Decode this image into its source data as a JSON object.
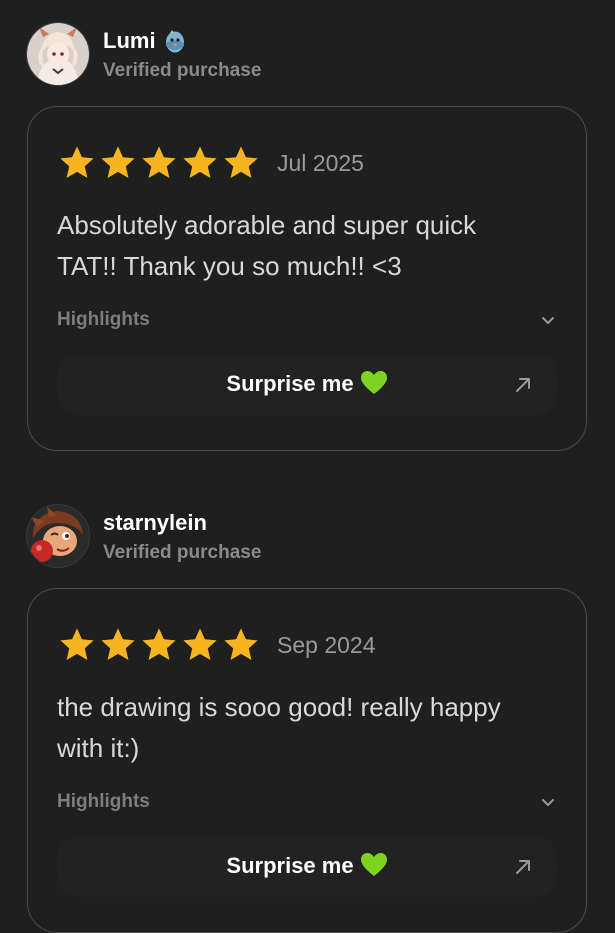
{
  "reviews": [
    {
      "reviewer": {
        "name": "Lumi",
        "status": "Verified purchase",
        "badge_icon": "egg-creature-icon",
        "avatar_icon": "anime-girl-avatar"
      },
      "rating": 5,
      "rating_max": 5,
      "date": "Jul 2025",
      "text": "Absolutely adorable and super quick TAT!! Thank you so much!! <3",
      "highlights_label": "Highlights",
      "option": {
        "label": "Surprise me",
        "emoji": "💚",
        "icon": "arrow-up-right-icon"
      }
    },
    {
      "reviewer": {
        "name": "starnylein",
        "status": "Verified purchase",
        "avatar_icon": "cartoon-boy-avatar"
      },
      "rating": 5,
      "rating_max": 5,
      "date": "Sep 2024",
      "text": "the drawing is sooo good! really happy with it:)",
      "highlights_label": "Highlights",
      "option": {
        "label": "Surprise me",
        "emoji": "💚",
        "icon": "arrow-up-right-icon"
      }
    }
  ],
  "colors": {
    "background": "#1f1f1f",
    "star": "#f6b51e",
    "heart": "#7ed321",
    "card_border": "#4a4a4a",
    "muted_text": "#8a8a8a"
  }
}
